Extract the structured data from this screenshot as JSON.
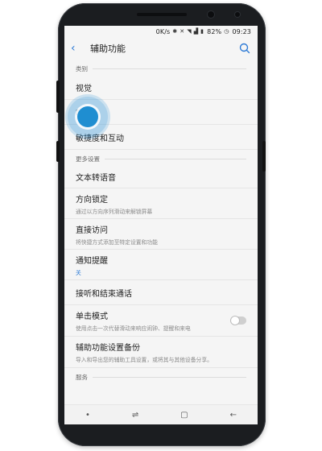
{
  "status_bar": {
    "speed": "0K/s",
    "battery": "82%",
    "time": "09:23"
  },
  "app_bar": {
    "title": "辅助功能"
  },
  "sections": [
    {
      "header": "类别",
      "items": [
        {
          "label": "视觉"
        },
        {
          "label": "听觉"
        },
        {
          "label": "敏捷度和互动"
        }
      ]
    },
    {
      "header": "更多设置",
      "items": [
        {
          "label": "文本转语音"
        },
        {
          "label": "方向锁定",
          "sub": "通过以方向序列滑动来解锁屏幕"
        },
        {
          "label": "直接访问",
          "sub": "将快捷方式添加至特定设置和功能"
        },
        {
          "label": "通知提醒",
          "sub": "关"
        },
        {
          "label": "接听和结束通话"
        },
        {
          "label": "单击模式",
          "sub": "使用点击一次代替滑动来响应闹钟、提醒和来电",
          "toggle": false
        },
        {
          "label": "辅助功能设置备份",
          "sub": "导入和导出您的辅助工具设置，或将其与其他设备分享。"
        }
      ]
    },
    {
      "header": "服务",
      "items": []
    }
  ],
  "colors": {
    "accent": "#2e7bd6",
    "touch_indicator": "#1f8ed1"
  }
}
